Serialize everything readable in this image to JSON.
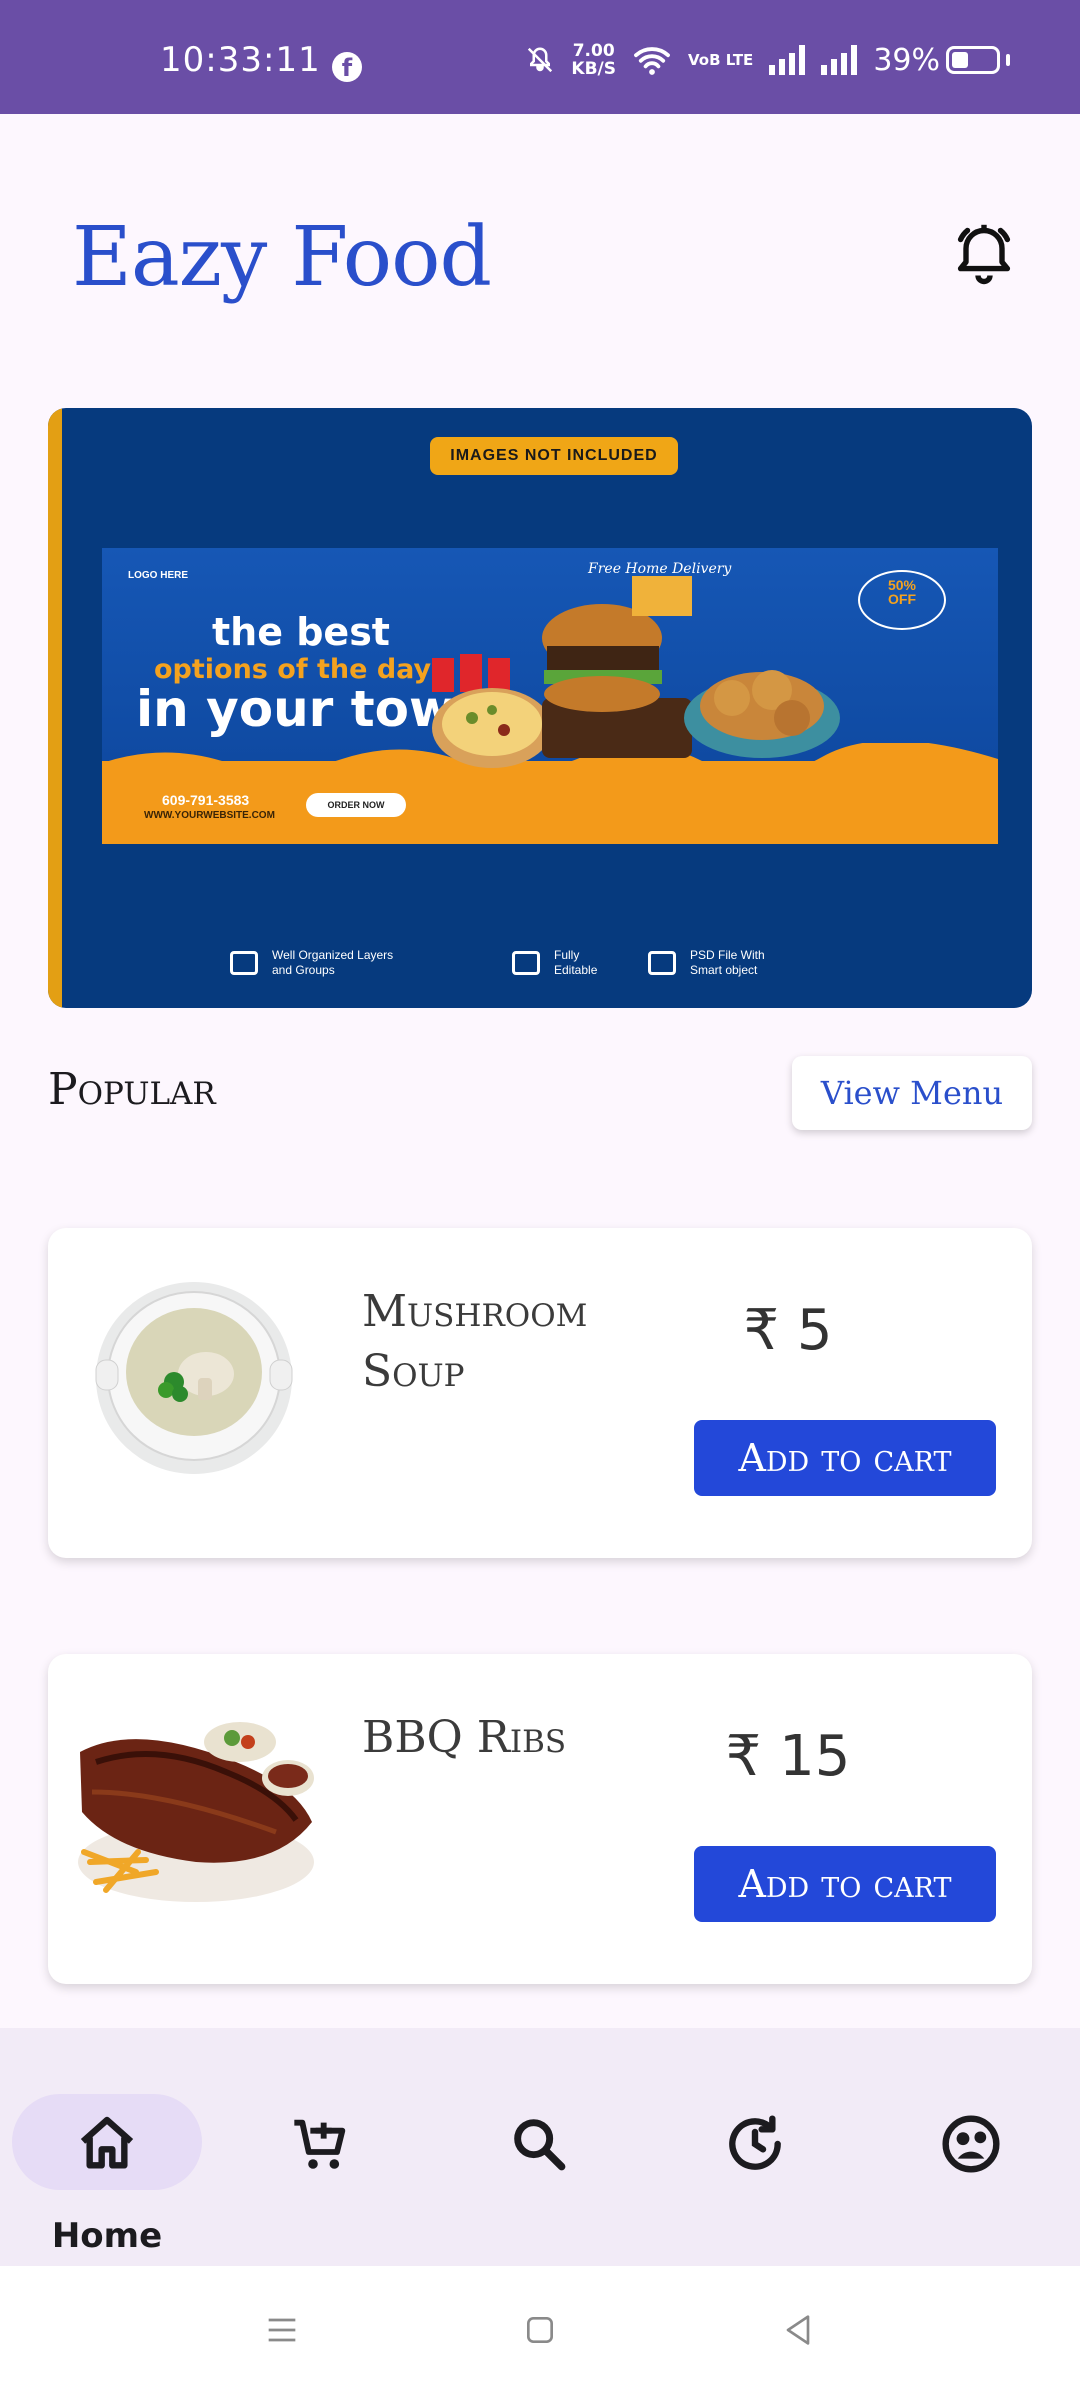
{
  "status_bar": {
    "time": "10:33:11",
    "net_speed": "7.00",
    "net_unit": "KB/S",
    "lte_label": "VoB LTE",
    "battery": "39%",
    "battery_level": 0.39
  },
  "header": {
    "title": "Eazy Food"
  },
  "banner": {
    "tag": "IMAGES NOT INCLUDED",
    "logo": "LOGO HERE",
    "line1": "the best",
    "line2": "options of the day",
    "line3": "in your town",
    "phone": "609-791-3583",
    "website": "WWW.YOURWEBSITE.COM",
    "order_button": "ORDER NOW",
    "delivery": "Free Home Delivery",
    "discount": "50%",
    "discount_label": "OFF",
    "features": [
      {
        "label": "Well Organized Layers and Groups"
      },
      {
        "label": "Fully Editable"
      },
      {
        "label": "PSD File With Smart object"
      }
    ]
  },
  "popular": {
    "heading": "Popular",
    "view_menu": "View Menu"
  },
  "items": [
    {
      "name": "Mushroom Soup",
      "price": "₹ 5",
      "add_label": "Add to cart"
    },
    {
      "name": "BBQ Ribs",
      "price": "₹ 15",
      "add_label": "Add to cart"
    }
  ],
  "bottom_nav": {
    "items": [
      {
        "label": "Home",
        "icon": "home-icon",
        "active": true
      },
      {
        "label": "",
        "icon": "cart-icon",
        "active": false
      },
      {
        "label": "",
        "icon": "search-icon",
        "active": false
      },
      {
        "label": "",
        "icon": "history-icon",
        "active": false
      },
      {
        "label": "",
        "icon": "profile-icon",
        "active": false
      }
    ]
  },
  "colors": {
    "status_bar": "#6a4ea6",
    "accent": "#2a4fcb",
    "button": "#2348d9",
    "banner_bg": "#063a7e",
    "background": "#fdf7fe"
  }
}
